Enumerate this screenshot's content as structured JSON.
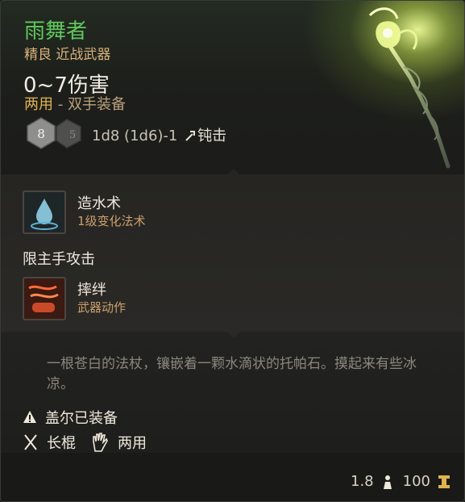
{
  "item": {
    "name": "雨舞者",
    "rarity_type": "精良 近战武器",
    "damage": "0~7伤害",
    "handedness": "两用",
    "handedness_sep": " - ",
    "handedness_detail": "双手装备",
    "dice": [
      "8",
      "5"
    ],
    "damage_roll": "1d8 (1d6)-1",
    "damage_type": "钝击",
    "description": "一根苍白的法杖，镶嵌着一颗水滴状的托帕石。摸起来有些冰凉。"
  },
  "skills": [
    {
      "name": "造水术",
      "subtitle": "1级变化法术",
      "icon": "water-drop-icon"
    },
    {
      "name": "摔绊",
      "subtitle": "武器动作",
      "icon": "trip-attack-icon"
    }
  ],
  "restriction": "限主手攻击",
  "meta": {
    "equipped": "盖尔已装备",
    "weapon_class": "长棍",
    "grip": "两用"
  },
  "footer": {
    "weight": "1.8",
    "value": "100"
  },
  "colors": {
    "rarity_green": "#5ec85a",
    "gold": "#e0b24c",
    "subtitle_tan": "#d9b27a"
  }
}
